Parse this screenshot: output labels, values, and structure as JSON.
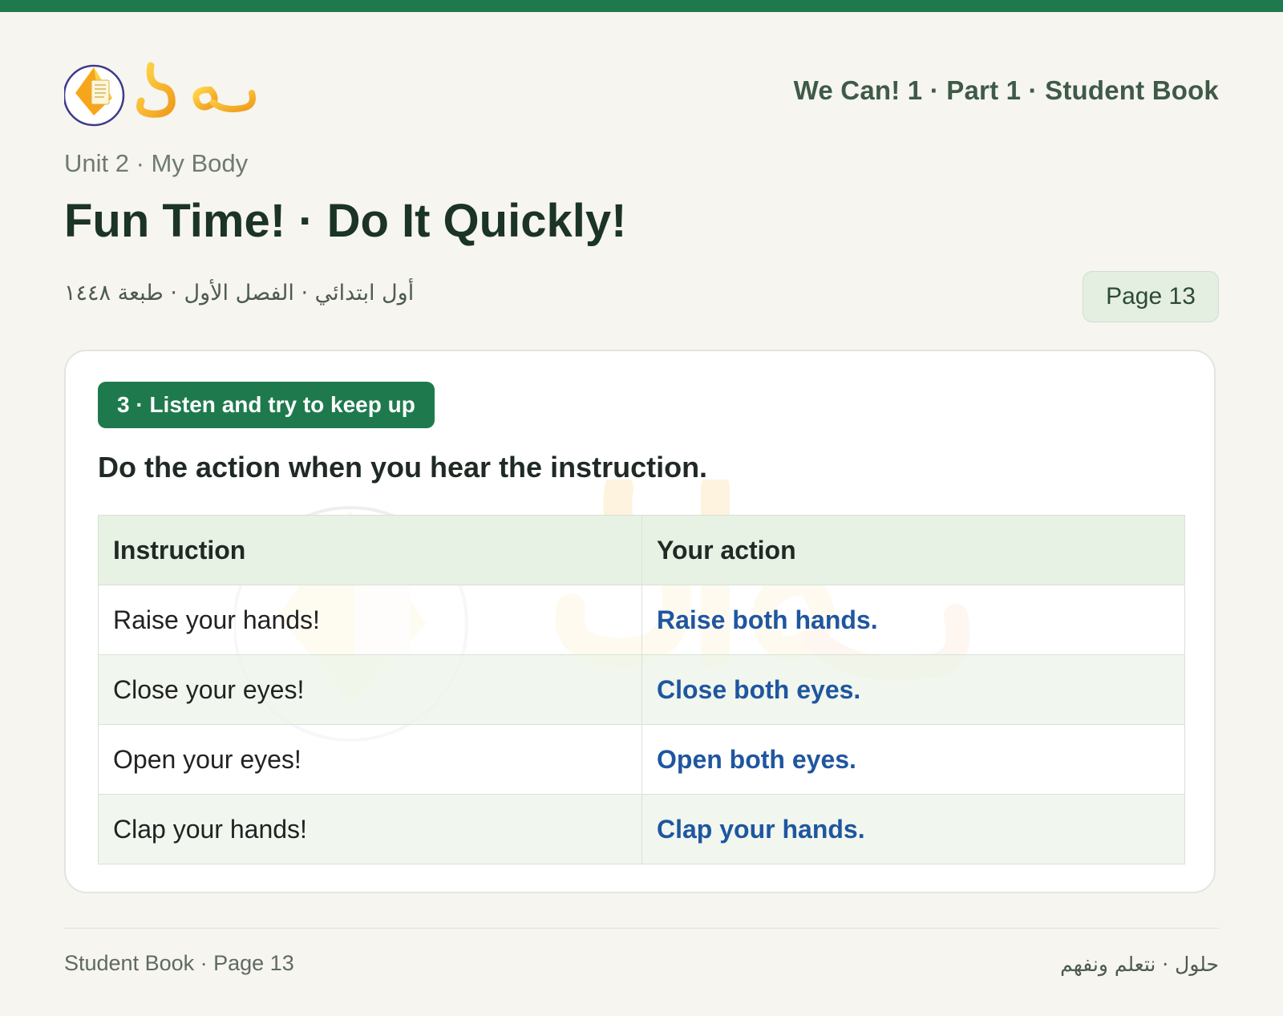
{
  "header": {
    "logo_text": "حلول",
    "book_title": "We Can! 1 · Part 1 · Student Book"
  },
  "unit": "Unit 2 · My Body",
  "title": "Fun Time! · Do It Quickly!",
  "arabic_subtitle": "أول ابتدائي · الفصل الأول · طبعة ١٤٤٨",
  "page_badge": "Page 13",
  "exercise": {
    "tag": "3 · Listen and try to keep up",
    "instruction": "Do the action when you hear the instruction.",
    "table": {
      "headers": [
        "Instruction",
        "Your action"
      ],
      "rows": [
        [
          "Raise your hands!",
          "Raise both hands."
        ],
        [
          "Close your eyes!",
          "Close both eyes."
        ],
        [
          "Open your eyes!",
          "Open both eyes."
        ],
        [
          "Clap your hands!",
          "Clap your hands."
        ]
      ]
    }
  },
  "footer": {
    "left": "Student Book · Page 13",
    "right": "حلول · نتعلم ونفهم"
  },
  "colors": {
    "accent_green": "#1e7a4d",
    "answer_blue": "#1f56a0",
    "logo_orange": "#f0a524"
  }
}
